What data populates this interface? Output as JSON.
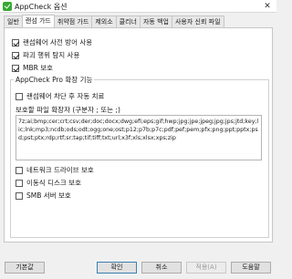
{
  "window": {
    "title": "AppCheck 옵션",
    "close_symbol": "✕"
  },
  "tabs": [
    {
      "label": "일반"
    },
    {
      "label": "랜섬 가드"
    },
    {
      "label": "취약점 가드"
    },
    {
      "label": "제외소"
    },
    {
      "label": "클리너"
    },
    {
      "label": "자동 백업"
    },
    {
      "label": "사용자 신뢰 파일"
    }
  ],
  "options": {
    "prevent_ransomware": {
      "label": "랜섬웨어 사전 방어 사용",
      "checked": true
    },
    "disk_destruction": {
      "label": "파괴 행위 탐지 사용",
      "checked": true
    },
    "mbr_protect": {
      "label": "MBR 보호",
      "checked": true
    }
  },
  "pro": {
    "group_title": "AppCheck Pro 확장 기능",
    "auto_block": {
      "label": "랜섬웨어 차단 후 자동 치료",
      "checked": false
    },
    "ext_label": "보호할 파일 확장자 (구분자 ; 또는 ;)",
    "ext_value": "7z;ai;bmp;cer;crt;csv;der;doc;docx;dwg;efi;eps;gif;hwp;jpg;jpe;jpeg;jpg;jps;jtd;key;lic;lnk;mp3;ncdb;ods;odt;ogg;one;ost;p12;p7b;p7c;pdf;pef;pem;pfx;png;ppt;pptx;psd;pst;ptx;rdp;rtf;sr;tap;tif;tiff;txt;url;x3f;xls;xlsx;xps;zip",
    "network_drive": {
      "label": "네트워크 드라이브 보호",
      "checked": false
    },
    "removable_disk": {
      "label": "이동식 디스크 보호",
      "checked": false
    },
    "smb_server": {
      "label": "SMB 서버 보호",
      "checked": false
    }
  },
  "buttons": {
    "defaults": "기본값",
    "ok": "확인",
    "cancel": "취소",
    "apply": "적용(A)",
    "help": "도움말"
  }
}
